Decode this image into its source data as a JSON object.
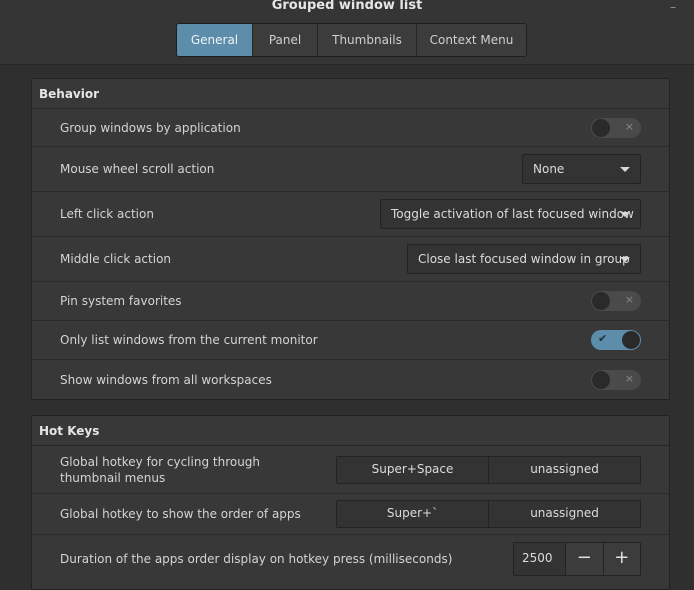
{
  "window": {
    "title": "Grouped window list",
    "minimize_glyph": "–"
  },
  "tabs": [
    {
      "label": "General",
      "active": true
    },
    {
      "label": "Panel",
      "active": false
    },
    {
      "label": "Thumbnails",
      "active": false
    },
    {
      "label": "Context Menu",
      "active": false
    }
  ],
  "behavior": {
    "title": "Behavior",
    "group_windows": {
      "label": "Group windows by application",
      "value": false
    },
    "scroll_action": {
      "label": "Mouse wheel scroll action",
      "value": "None"
    },
    "left_click": {
      "label": "Left click action",
      "value": "Toggle activation of last focused window"
    },
    "middle_click": {
      "label": "Middle click action",
      "value": "Close last focused window in group"
    },
    "pin_favorites": {
      "label": "Pin system favorites",
      "value": false
    },
    "current_monitor": {
      "label": "Only list windows from the current monitor",
      "value": true
    },
    "all_workspaces": {
      "label": "Show windows from all workspaces",
      "value": false
    }
  },
  "hotkeys": {
    "title": "Hot Keys",
    "cycle": {
      "label": "Global hotkey for cycling through thumbnail menus",
      "primary": "Super+Space",
      "secondary": "unassigned"
    },
    "order": {
      "label": "Global hotkey to show the order of apps",
      "primary": "Super+`",
      "secondary": "unassigned"
    },
    "duration": {
      "label": "Duration of the apps order display on hotkey press (milliseconds)",
      "value": "2500",
      "minus": "−",
      "plus": "+"
    }
  },
  "icons": {
    "toggle_off": "×",
    "toggle_on": "✔"
  },
  "colors": {
    "accent": "#5c8dab",
    "background": "#2f2f2f",
    "panel": "#383838"
  }
}
